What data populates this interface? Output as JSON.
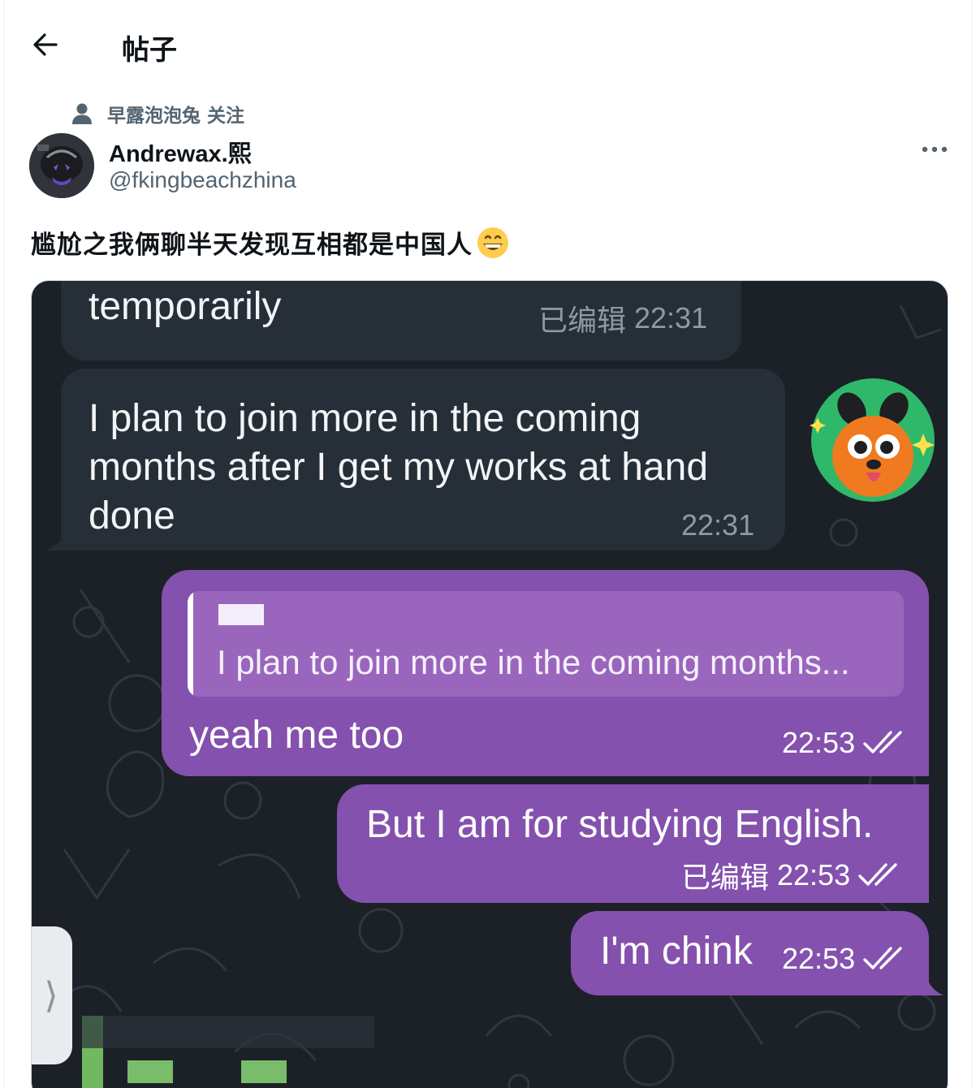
{
  "header": {
    "title": "帖子",
    "back_icon": "arrow-left-icon"
  },
  "social_context": {
    "icon": "person-icon",
    "name": "早露泡泡兔",
    "action": "关注"
  },
  "author": {
    "display_name": "Andrewax.熙",
    "handle": "@fkingbeachzhina"
  },
  "more_icon": "more-horizontal-icon",
  "tweet": {
    "text": "尴尬之我俩聊半天发现互相都是中国人",
    "emoji": "grinning-face-emoji"
  },
  "chat": {
    "messages": [
      {
        "direction": "incoming",
        "text": "temporarily",
        "edited_label": "已编辑",
        "time": "22:31"
      },
      {
        "direction": "incoming",
        "lines": [
          "I plan to join more in the coming",
          "months after I get my works at hand",
          "done"
        ],
        "time": "22:31"
      },
      {
        "direction": "outgoing",
        "reply_preview": "I plan to join more in the coming months...",
        "text": "yeah me too",
        "time": "22:53",
        "read": true
      },
      {
        "direction": "outgoing",
        "text": "But I am for studying English.",
        "edited_label": "已编辑",
        "time": "22:53",
        "read": true
      },
      {
        "direction": "outgoing",
        "text": "I'm chink",
        "time": "22:53",
        "read": true
      }
    ],
    "side_tab_glyph": "⟩",
    "colors": {
      "background": "#1c2128",
      "incoming": "#262e37",
      "outgoing": "#8451ae"
    }
  }
}
